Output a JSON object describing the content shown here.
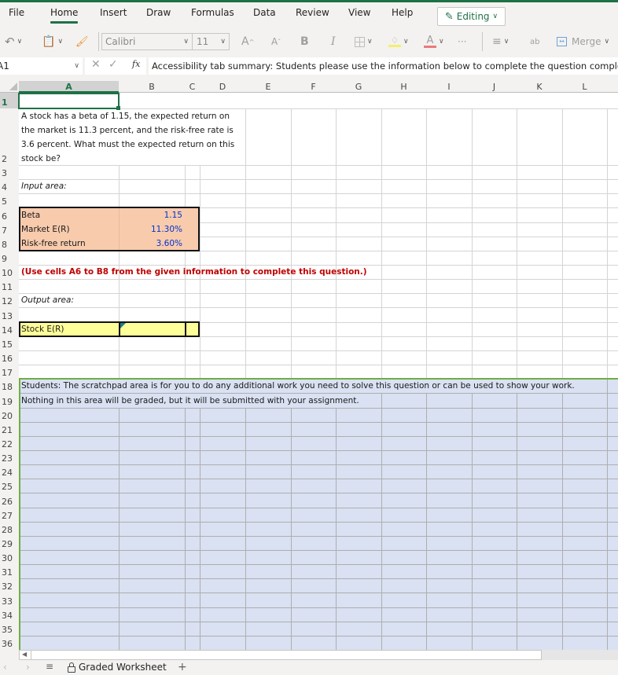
{
  "tabs": [
    "File",
    "Home",
    "Insert",
    "Draw",
    "Formulas",
    "Data",
    "Review",
    "View",
    "Help"
  ],
  "active_tab": "Home",
  "editing_label": "Editing",
  "ribbon": {
    "font_name": "Calibri",
    "font_size": "11",
    "increase_font": "A",
    "decrease_font": "A",
    "bold": "B",
    "italic": "I",
    "font_color": "A",
    "more": "···",
    "wrap": "ab",
    "merge_label": "Merge"
  },
  "formula_bar": {
    "name_box": "A1",
    "fx": "fx",
    "content": "Accessibility tab summary: Students please use the information below to complete the question completing the"
  },
  "columns": [
    "A",
    "B",
    "C",
    "D",
    "E",
    "F",
    "G",
    "H",
    "I",
    "J",
    "K",
    "L"
  ],
  "selected_column": "A",
  "selected_row": "1",
  "rows": [
    "1",
    "2",
    "3",
    "4",
    "5",
    "6",
    "7",
    "8",
    "9",
    "10",
    "11",
    "12",
    "13",
    "14",
    "15",
    "16",
    "17",
    "18",
    "19",
    "20",
    "21",
    "22",
    "23",
    "24",
    "25",
    "26",
    "27",
    "28",
    "29",
    "30",
    "31",
    "32",
    "33",
    "34",
    "35",
    "36"
  ],
  "cells": {
    "question_lines": [
      "A stock has a beta of 1.15, the expected return on",
      "the market is 11.3 percent, and the risk-free rate is",
      "3.6 percent. What must the expected return on this",
      "stock be?"
    ],
    "input_area_label": "Input area:",
    "inputs": [
      {
        "label": "Beta",
        "value": "1.15"
      },
      {
        "label": "Market E(R)",
        "value": "11.30%"
      },
      {
        "label": "Risk-free return",
        "value": "3.60%"
      }
    ],
    "instruction": "(Use cells A6 to B8 from the given information to complete this question.)",
    "output_area_label": "Output area:",
    "output_label": "Stock E(R)",
    "output_value": "",
    "scratch_line1": "Students: The scratchpad area is for you to do any additional work you need to solve this question or can be used to show your work.",
    "scratch_line2": "Nothing in this area will be graded, but it will be submitted with your assignment."
  },
  "colors": {
    "accent": "#1e7145",
    "input_fill": "#f8cbad",
    "output_fill": "#ffff99",
    "scratch_fill": "#d9e1f2",
    "instruction_text": "#c00000",
    "input_value_text": "#0033cc"
  },
  "sheet_tab": {
    "name": "Graded Worksheet",
    "add": "+"
  }
}
